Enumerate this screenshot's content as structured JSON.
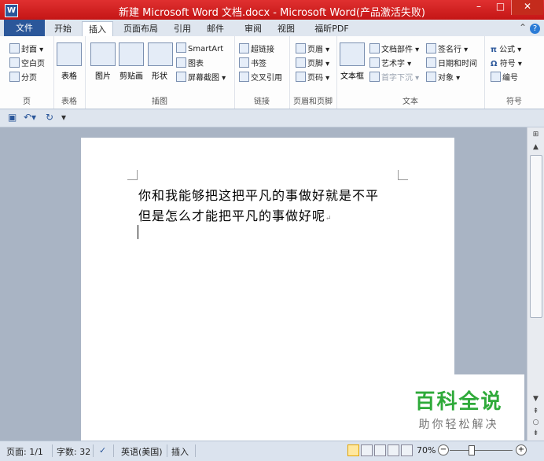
{
  "window": {
    "app_icon": "W",
    "title": "新建 Microsoft Word 文档.docx - Microsoft Word(产品激活失败)",
    "buttons": {
      "minimize": "–",
      "maximize": "□",
      "close": "✕"
    }
  },
  "tabs": {
    "file": "文件",
    "items": [
      "开始",
      "插入",
      "页面布局",
      "引用",
      "邮件",
      "审阅",
      "视图",
      "福昕PDF"
    ],
    "active": "插入",
    "help": "?"
  },
  "ribbon": {
    "pages": {
      "cover": "封面",
      "blank": "空白页",
      "break": "分页",
      "label": "页"
    },
    "tables": {
      "table": "表格",
      "label": "表格"
    },
    "illustrations": {
      "picture": "图片",
      "clipart": "剪贴画",
      "shapes": "形状",
      "smartart": "SmartArt",
      "chart": "图表",
      "screenshot": "屏幕截图",
      "label": "插图"
    },
    "links": {
      "hyperlink": "超链接",
      "bookmark": "书签",
      "crossref": "交叉引用",
      "label": "链接"
    },
    "header_footer": {
      "header": "页眉",
      "footer": "页脚",
      "page_number": "页码",
      "label": "页眉和页脚"
    },
    "text": {
      "textbox": "文本框",
      "quick_parts": "文档部件",
      "wordart": "艺术字",
      "dropcap": "首字下沉",
      "signature": "签名行",
      "datetime": "日期和时间",
      "object": "对象",
      "label": "文本"
    },
    "symbols": {
      "equation": "公式",
      "symbol": "符号",
      "number": "编号",
      "label": "符号"
    }
  },
  "document": {
    "lines": [
      "你和我能够把这把平凡的事做好就是不平",
      "但是怎么才能把平凡的事做好呢"
    ]
  },
  "watermark": {
    "title": "百科全说",
    "subtitle": "助你轻松解决"
  },
  "status": {
    "page": "页面: 1/1",
    "words": "字数: 32",
    "language": "英语(美国)",
    "mode": "插入",
    "zoom": "70%",
    "zoom_level": 0.7
  }
}
